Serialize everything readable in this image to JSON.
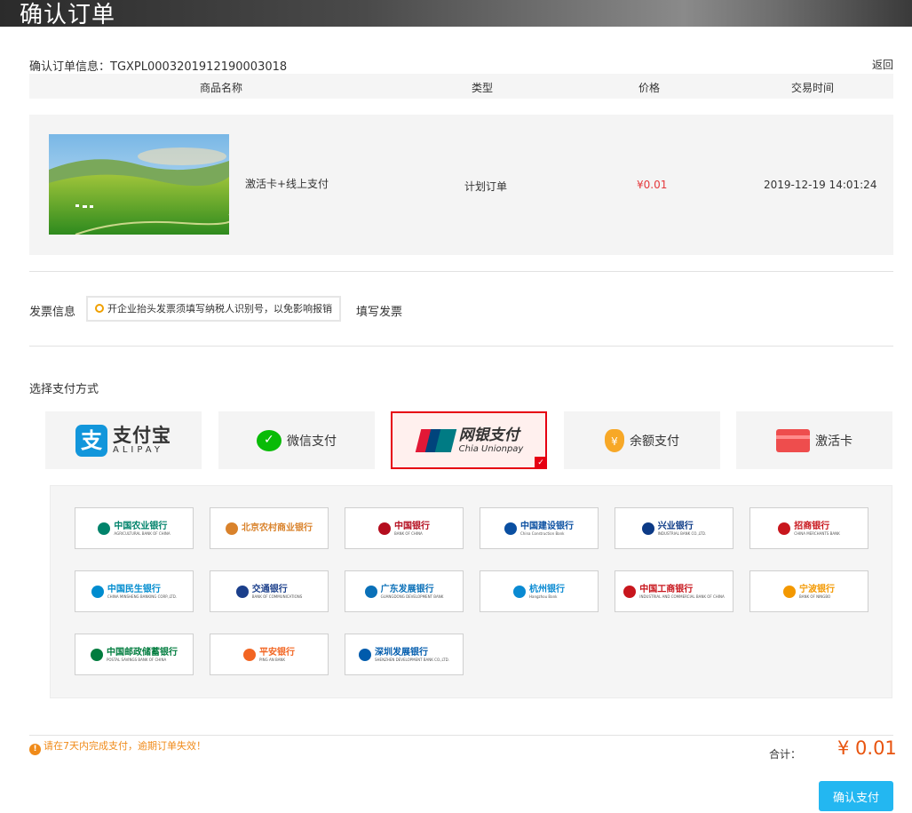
{
  "header": {
    "title": "确认订单"
  },
  "order": {
    "info_label": "确认订单信息：",
    "order_no": "TGXPL0003201912190003018",
    "back_label": "返回"
  },
  "table": {
    "headers": [
      "商品名称",
      "类型",
      "价格",
      "交易时间"
    ],
    "row": {
      "name": "激活卡+线上支付",
      "type": "计划订单",
      "price": "¥0.01",
      "time": "2019-12-19 14:01:24"
    }
  },
  "invoice": {
    "label": "发票信息",
    "tip": "开企业抬头发票须填写纳税人识别号，以免影响报销",
    "fill_label": "填写发票"
  },
  "payment": {
    "label": "选择支付方式",
    "tabs": {
      "alipay_big": "支付宝",
      "alipay_small": "ALIPAY",
      "wechat": "微信支付",
      "union_big": "网银支付",
      "union_small": "Chia Unionpay",
      "balance": "余额支付",
      "card": "激活卡"
    }
  },
  "banks": [
    {
      "name": "中国农业银行",
      "en": "AGRICULTURAL BANK OF CHINA",
      "color": "#00836b"
    },
    {
      "name": "北京农村商业银行",
      "en": "",
      "color": "#d9822b"
    },
    {
      "name": "中国银行",
      "en": "BANK OF CHINA",
      "color": "#b40d1e"
    },
    {
      "name": "中国建设银行",
      "en": "China Construction Bank",
      "color": "#0a4fa1"
    },
    {
      "name": "兴业银行",
      "en": "INDUSTRIAL BANK CO.,LTD.",
      "color": "#0c3a86"
    },
    {
      "name": "招商银行",
      "en": "CHINA MERCHANTS BANK",
      "color": "#c8161d"
    },
    {
      "name": "中国民生银行",
      "en": "CHINA MINSHENG BANKING CORP.,LTD.",
      "color": "#008ccf"
    },
    {
      "name": "交通银行",
      "en": "BANK OF COMMUNICATIONS",
      "color": "#1b3f8b"
    },
    {
      "name": "广东发展银行",
      "en": "GUANGDONG DEVELOPMENT BANK",
      "color": "#0a70b8"
    },
    {
      "name": "杭州银行",
      "en": "Hangzhou Bank",
      "color": "#0a8ad2"
    },
    {
      "name": "中国工商银行",
      "en": "INDUSTRIAL AND COMMERCIAL BANK OF CHINA",
      "color": "#c8161d"
    },
    {
      "name": "宁波银行",
      "en": "BANK OF NINGBO",
      "color": "#f39800"
    },
    {
      "name": "中国邮政储蓄银行",
      "en": "POSTAL SAVINGS BANK OF CHINA",
      "color": "#007c3e"
    },
    {
      "name": "平安银行",
      "en": "PING AN BANK",
      "color": "#f26522"
    },
    {
      "name": "深圳发展银行",
      "en": "SHENZHEN DEVELOPMENT BANK CO.,LTD.",
      "color": "#005bac"
    }
  ],
  "footer": {
    "warning": "请在7天内完成支付，逾期订单失效！",
    "total_label": "合计：",
    "total_value": "¥ 0.01",
    "confirm_label": "确认支付"
  }
}
